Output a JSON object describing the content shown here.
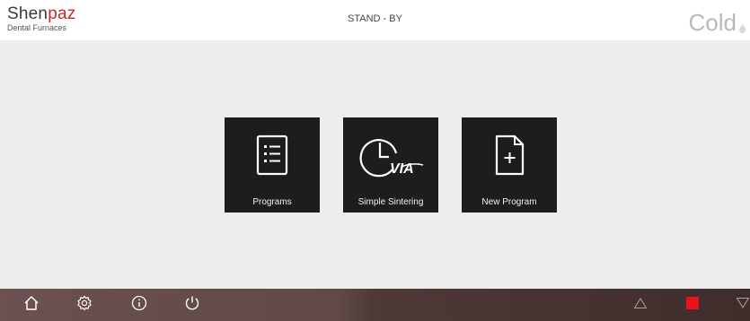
{
  "header": {
    "logo": {
      "name_main": "Shen",
      "name_accent": "paz",
      "subtitle": "Dental Furnaces"
    },
    "status": "STAND - BY",
    "temperature_state": "Cold",
    "flame_icon": "flame-icon"
  },
  "tiles": [
    {
      "label": "Programs",
      "icon": "list-document-icon"
    },
    {
      "label": "Simple Sintering",
      "icon": "clock-via-icon"
    },
    {
      "label": "New Program",
      "icon": "new-document-icon"
    }
  ],
  "footer": {
    "left_icons": [
      "home-icon",
      "settings-icon",
      "info-icon",
      "power-icon"
    ],
    "right_icons": [
      "up-triangle-icon",
      "stop-icon",
      "down-triangle-icon"
    ],
    "stop_color": "#e8141b"
  }
}
